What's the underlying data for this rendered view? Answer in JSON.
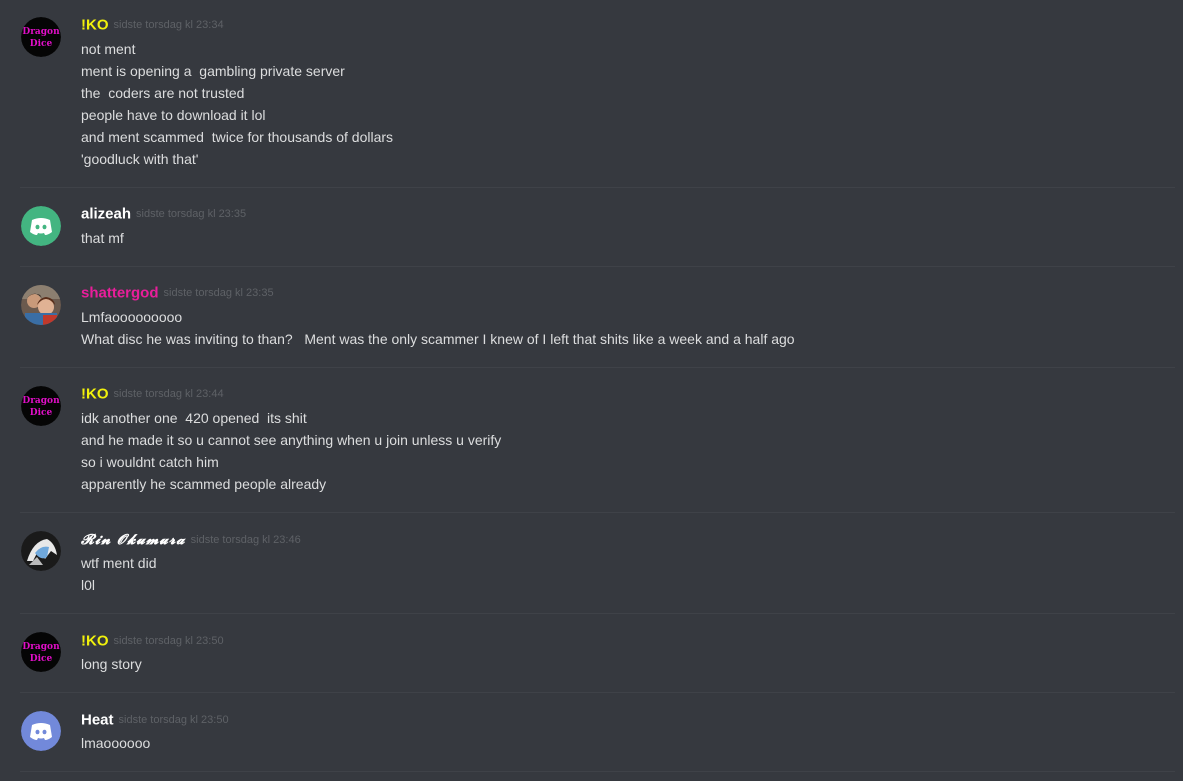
{
  "colors": {
    "background": "#36393f",
    "divider": "#3f4248",
    "message_text": "#dcddde",
    "timestamp": "#5e6166",
    "ko_name": "#f1f10c",
    "alizeah_name": "#ffffff",
    "shattergod_name": "#e91e9b",
    "rin_name": "#ffffff",
    "heat_name": "#ffffff",
    "discord_green": "#43b581",
    "discord_blurple": "#7289da",
    "dragon_dice_pink": "#e10fc8"
  },
  "messages": [
    {
      "author": "!KO",
      "avatar": "dragon-dice-icon",
      "avatar_text": [
        "Dragon",
        "Dice"
      ],
      "timestamp": "sidste torsdag kl 23:34",
      "lines": [
        "not ment",
        "ment is opening a  gambling private server",
        "the  coders are not trusted",
        "people have to download it lol",
        "and ment scammed  twice for thousands of dollars",
        "'goodluck with that'"
      ]
    },
    {
      "author": "alizeah",
      "avatar": "discord-green-icon",
      "timestamp": "sidste torsdag kl 23:35",
      "lines": [
        "that mf"
      ]
    },
    {
      "author": "shattergod",
      "avatar": "couple-photo-icon",
      "timestamp": "sidste torsdag kl 23:35",
      "lines": [
        "Lmfaooooooooo",
        "What disc he was inviting to than?   Ment was the only scammer I knew of I left that shits like a week and a half ago"
      ]
    },
    {
      "author": "!KO",
      "avatar": "dragon-dice-icon",
      "avatar_text": [
        "Dragon",
        "Dice"
      ],
      "timestamp": "sidste torsdag kl 23:44",
      "lines": [
        "idk another one  420 opened  its shit",
        "and he made it so u cannot see anything when u join unless u verify",
        "so i wouldnt catch him",
        "apparently he scammed people already"
      ]
    },
    {
      "author": "𝓡𝓲𝓷 𝓞𝓴𝓾𝓶𝓾𝓻𝓪",
      "avatar": "anime-character-icon",
      "timestamp": "sidste torsdag kl 23:46",
      "lines": [
        "wtf ment did",
        "l0l"
      ]
    },
    {
      "author": "!KO",
      "avatar": "dragon-dice-icon",
      "avatar_text": [
        "Dragon",
        "Dice"
      ],
      "timestamp": "sidste torsdag kl 23:50",
      "lines": [
        "long story"
      ]
    },
    {
      "author": "Heat",
      "avatar": "discord-blurple-icon",
      "timestamp": "sidste torsdag kl 23:50",
      "lines": [
        "lmaoooooo"
      ]
    }
  ]
}
